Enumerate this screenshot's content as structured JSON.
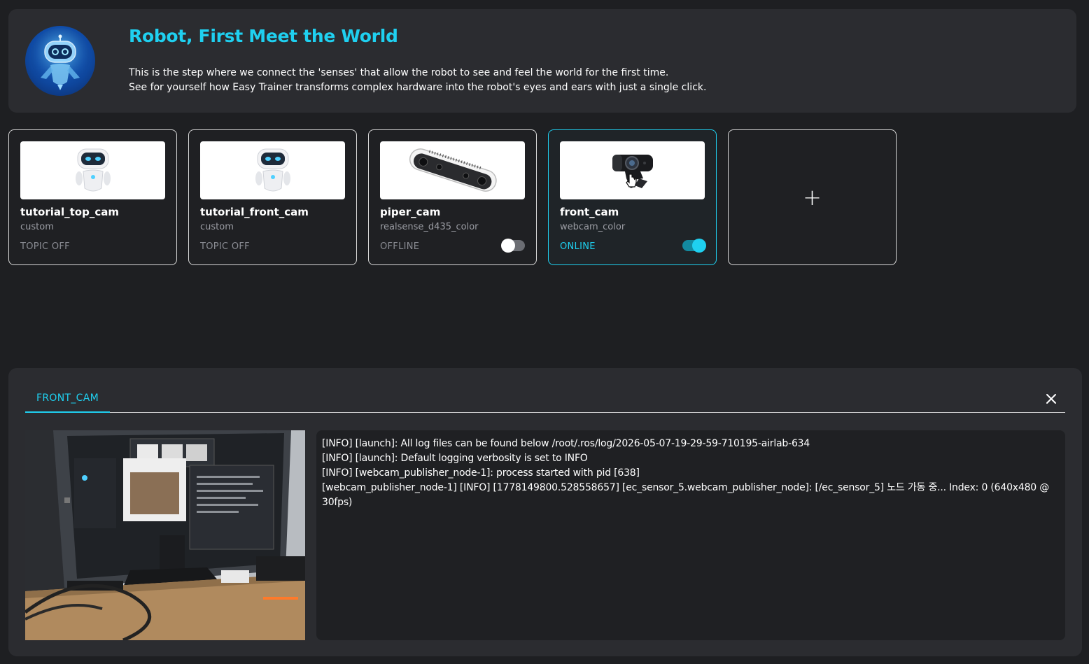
{
  "banner": {
    "title": "Robot, First Meet the World",
    "description_line1": "This is the step where we connect the 'senses' that allow the robot to see and feel the world for the first time.",
    "description_line2": "See for yourself how Easy Trainer transforms complex hardware into the robot's eyes and ears with just a single click.",
    "avatar_icon": "robot-mascot-icon"
  },
  "sensors": [
    {
      "name": "tutorial_top_cam",
      "type": "custom",
      "status": "TOPIC OFF",
      "thumbnail_icon": "robot-mascot-icon",
      "has_toggle": false,
      "active": false
    },
    {
      "name": "tutorial_front_cam",
      "type": "custom",
      "status": "TOPIC OFF",
      "thumbnail_icon": "robot-mascot-icon",
      "has_toggle": false,
      "active": false
    },
    {
      "name": "piper_cam",
      "type": "realsense_d435_color",
      "status": "OFFLINE",
      "thumbnail_icon": "depth-camera-icon",
      "has_toggle": true,
      "toggle_on": false,
      "active": false
    },
    {
      "name": "front_cam",
      "type": "webcam_color",
      "status": "ONLINE",
      "thumbnail_icon": "webcam-icon",
      "has_toggle": true,
      "toggle_on": true,
      "active": true
    }
  ],
  "add_card": {
    "symbol": "+",
    "icon": "plus-icon"
  },
  "panel": {
    "tab_label": "FRONT_CAM",
    "close_icon": "close-icon",
    "log_lines": [
      "[INFO] [launch]: All log files can be found below /root/.ros/log/2026-05-07-19-29-59-710195-airlab-634",
      "[INFO] [launch]: Default logging verbosity is set to INFO",
      "[INFO] [webcam_publisher_node-1]: process started with pid [638]",
      "[webcam_publisher_node-1] [INFO] [1778149800.528558657] [ec_sensor_5.webcam_publisher_node]: [/ec_sensor_5] 노드 가동 중... Index: 0 (640x480 @ 30fps)"
    ]
  },
  "colors": {
    "accent": "#1fd0f0",
    "background": "#1e1f22",
    "panel": "#2b2c30",
    "card": "#1f2023"
  }
}
